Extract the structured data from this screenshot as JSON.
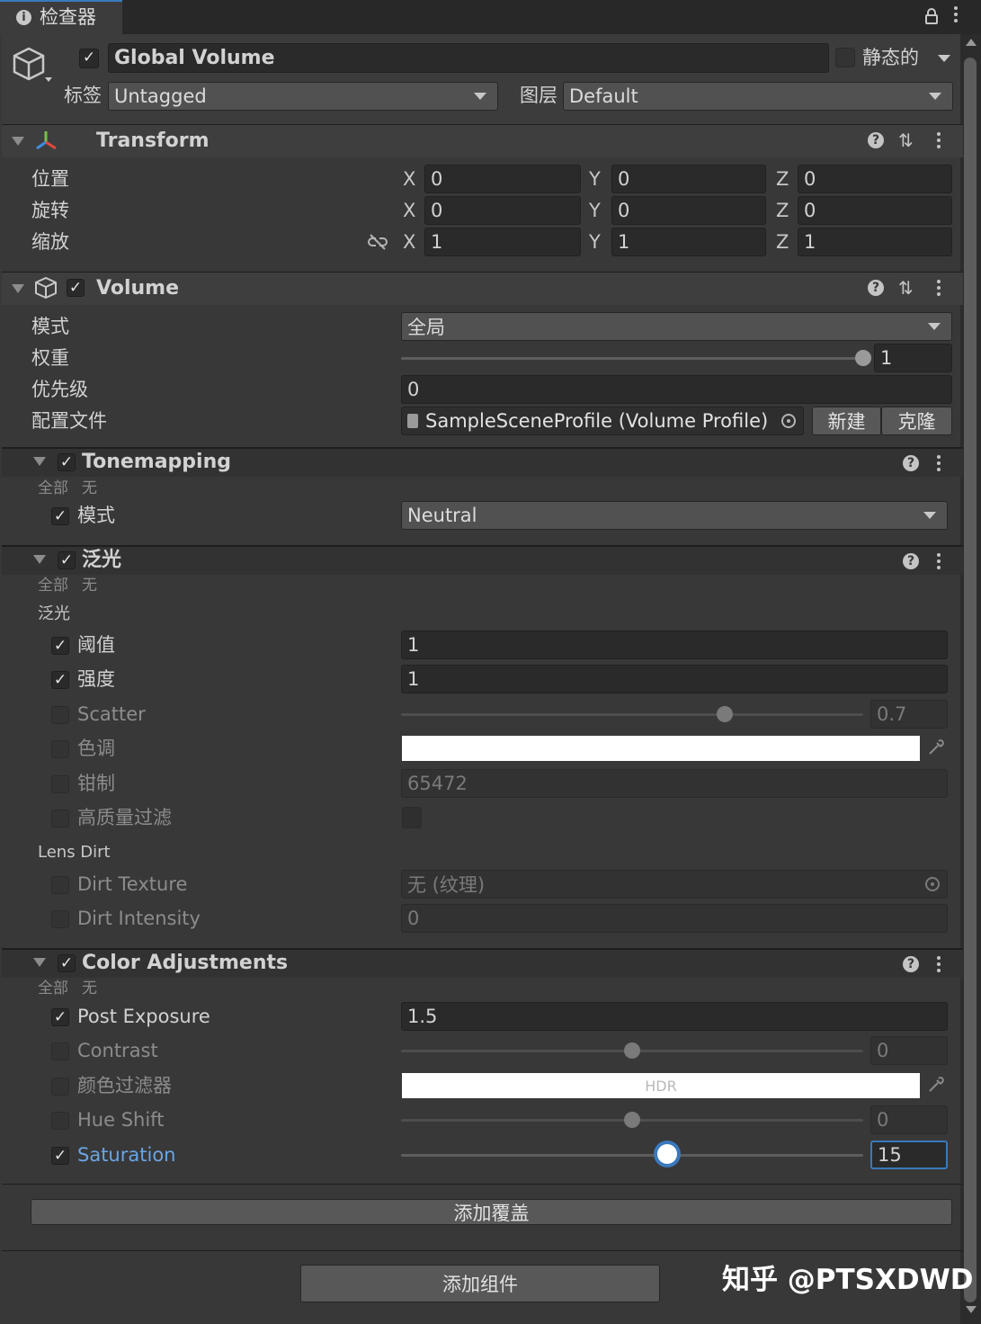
{
  "tab": {
    "title": "检查器"
  },
  "object": {
    "name": "Global Volume",
    "static_label": "静态的",
    "tag_label": "标签",
    "tag_value": "Untagged",
    "layer_label": "图层",
    "layer_value": "Default"
  },
  "transform": {
    "title": "Transform",
    "rows": [
      {
        "label": "位置",
        "x": "0",
        "y": "0",
        "z": "0"
      },
      {
        "label": "旋转",
        "x": "0",
        "y": "0",
        "z": "0"
      },
      {
        "label": "缩放",
        "x": "1",
        "y": "1",
        "z": "1"
      }
    ],
    "axes": {
      "x": "X",
      "y": "Y",
      "z": "Z"
    }
  },
  "volume": {
    "title": "Volume",
    "mode_label": "模式",
    "mode_value": "全局",
    "weight_label": "权重",
    "weight_value": "1",
    "weight_fraction": 1.0,
    "priority_label": "优先级",
    "priority_value": "0",
    "profile_label": "配置文件",
    "profile_value": "SampleSceneProfile (Volume Profile)",
    "new_button": "新建",
    "clone_button": "克隆"
  },
  "tonemapping": {
    "title": "Tonemapping",
    "all_label": "全部",
    "none_label": "无",
    "mode_label": "模式",
    "mode_value": "Neutral"
  },
  "bloom": {
    "title": "泛光",
    "all_label": "全部",
    "none_label": "无",
    "section_label": "泛光",
    "threshold_label": "阈值",
    "threshold_value": "1",
    "intensity_label": "强度",
    "intensity_value": "1",
    "scatter_label": "Scatter",
    "scatter_value": "0.7",
    "scatter_fraction": 0.7,
    "tint_label": "色调",
    "clamp_label": "钳制",
    "clamp_value": "65472",
    "hq_label": "高质量过滤",
    "lens_dirt_label": "Lens Dirt",
    "dirt_texture_label": "Dirt Texture",
    "dirt_texture_value": "无 (纹理)",
    "dirt_intensity_label": "Dirt Intensity",
    "dirt_intensity_value": "0"
  },
  "color_adjustments": {
    "title": "Color Adjustments",
    "all_label": "全部",
    "none_label": "无",
    "post_exposure_label": "Post Exposure",
    "post_exposure_value": "1.5",
    "contrast_label": "Contrast",
    "contrast_value": "0",
    "contrast_fraction": 0.5,
    "color_filter_label": "颜色过滤器",
    "color_filter_hdr": "HDR",
    "hue_shift_label": "Hue Shift",
    "hue_shift_value": "0",
    "hue_shift_fraction": 0.5,
    "saturation_label": "Saturation",
    "saturation_value": "15",
    "saturation_fraction": 0.575
  },
  "footer": {
    "add_override": "添加覆盖",
    "add_component": "添加组件"
  },
  "watermark": "知乎 @PTSXDWD",
  "colors": {
    "accent": "#6aa5e6",
    "background": "#383838",
    "field": "#2a2a2a"
  }
}
